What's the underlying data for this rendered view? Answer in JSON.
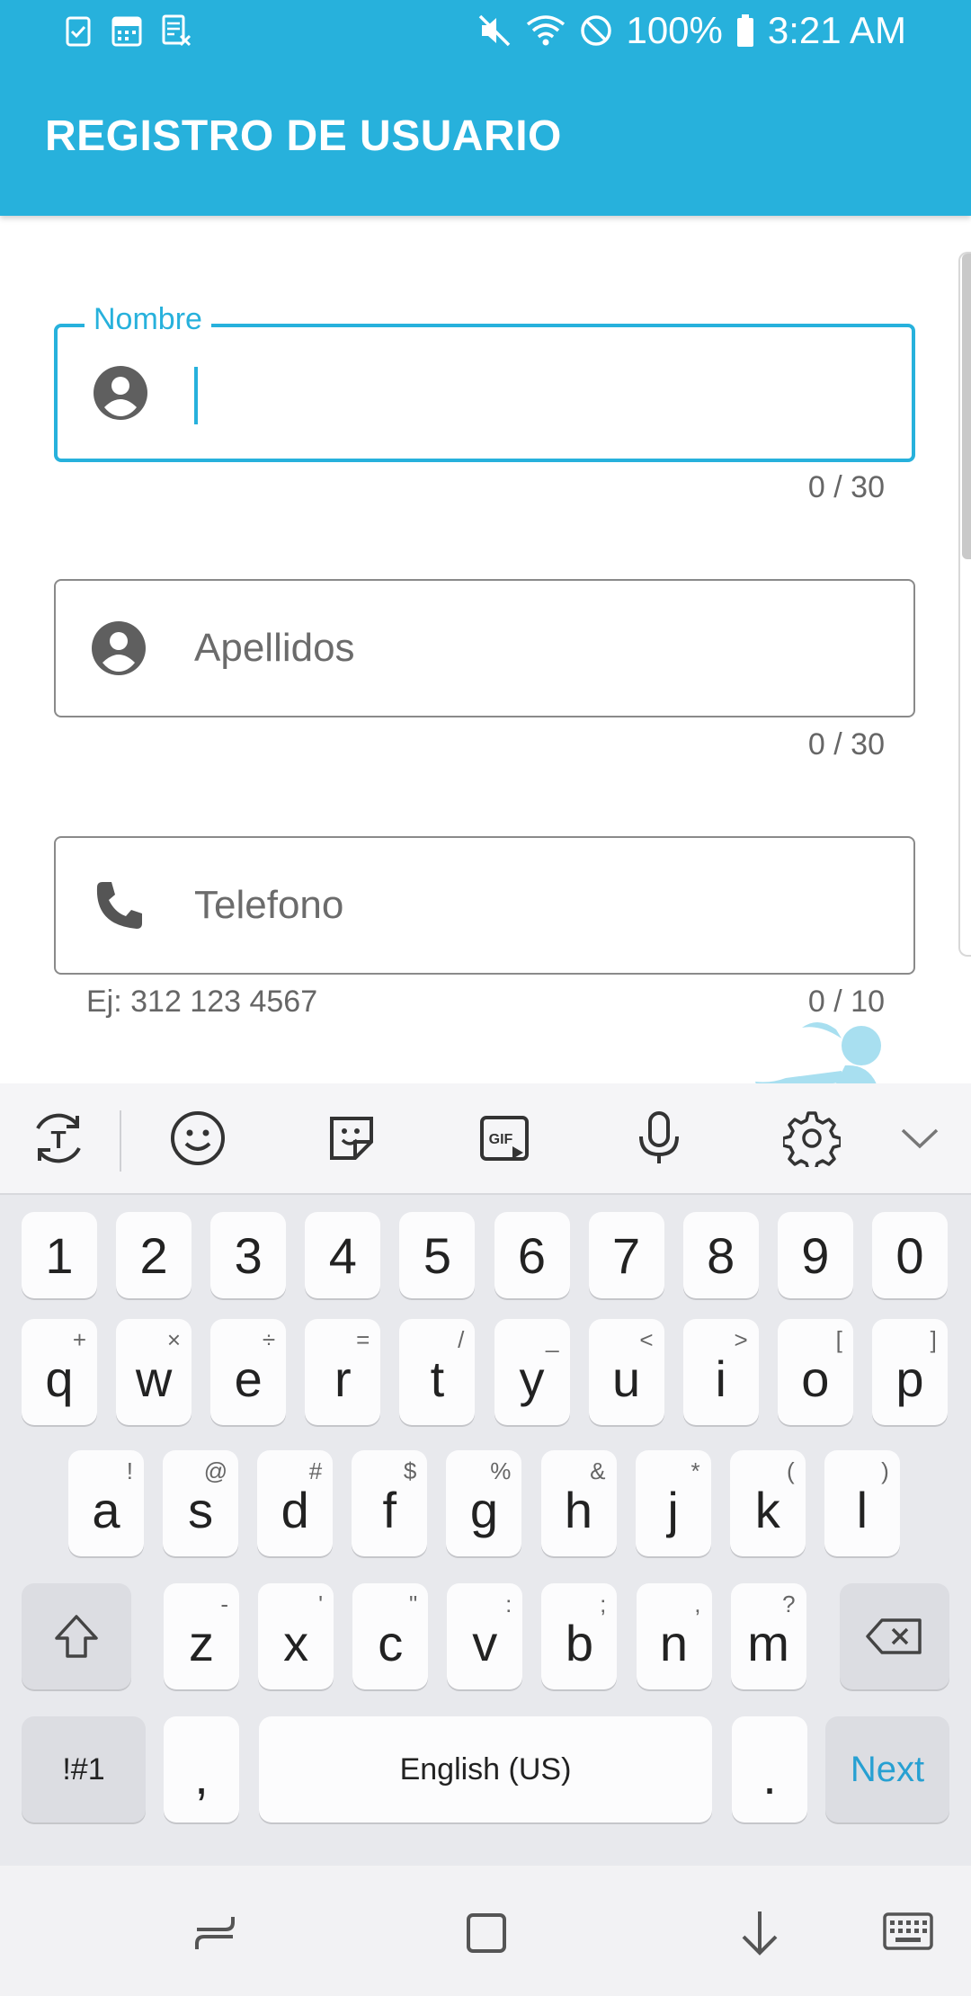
{
  "status_bar": {
    "battery": "100%",
    "time": "3:21 AM",
    "icons": [
      "clipboard-check-icon",
      "calendar-icon",
      "sheet-icon",
      "mute-icon",
      "wifi-icon",
      "blocked-icon",
      "battery-icon"
    ]
  },
  "app_bar": {
    "title": "REGISTRO DE USUARIO",
    "color": "#27b1dc"
  },
  "form": {
    "nombre": {
      "label": "Nombre",
      "value": "",
      "counter": "0 / 30",
      "icon": "account-circle-icon"
    },
    "apellidos": {
      "placeholder": "Apellidos",
      "counter": "0 / 30",
      "icon": "account-circle-icon"
    },
    "telefono": {
      "placeholder": "Telefono",
      "helper": "Ej: 312 123 4567",
      "counter": "0 / 10",
      "icon": "phone-icon"
    }
  },
  "keyboard": {
    "toolbar_icons": [
      "text-mode-icon",
      "emoji-icon",
      "sticker-icon",
      "gif-icon",
      "microphone-icon",
      "settings-icon",
      "collapse-icon"
    ],
    "number_row": [
      "1",
      "2",
      "3",
      "4",
      "5",
      "6",
      "7",
      "8",
      "9",
      "0"
    ],
    "row1": [
      {
        "k": "q",
        "h": "+"
      },
      {
        "k": "w",
        "h": "×"
      },
      {
        "k": "e",
        "h": "÷"
      },
      {
        "k": "r",
        "h": "="
      },
      {
        "k": "t",
        "h": "/"
      },
      {
        "k": "y",
        "h": "_"
      },
      {
        "k": "u",
        "h": "<"
      },
      {
        "k": "i",
        "h": ">"
      },
      {
        "k": "o",
        "h": "["
      },
      {
        "k": "p",
        "h": "]"
      }
    ],
    "row2": [
      {
        "k": "a",
        "h": "!"
      },
      {
        "k": "s",
        "h": "@"
      },
      {
        "k": "d",
        "h": "#"
      },
      {
        "k": "f",
        "h": "$"
      },
      {
        "k": "g",
        "h": "%"
      },
      {
        "k": "h",
        "h": "&"
      },
      {
        "k": "j",
        "h": "*"
      },
      {
        "k": "k",
        "h": "("
      },
      {
        "k": "l",
        "h": ")"
      }
    ],
    "row3": [
      {
        "k": "z",
        "h": "-"
      },
      {
        "k": "x",
        "h": "'"
      },
      {
        "k": "c",
        "h": "\""
      },
      {
        "k": "v",
        "h": ":"
      },
      {
        "k": "b",
        "h": ";"
      },
      {
        "k": "n",
        "h": ","
      },
      {
        "k": "m",
        "h": "?"
      }
    ],
    "symbols_key": "!#1",
    "comma_key": ",",
    "space_key": "English (US)",
    "period_key": ".",
    "action_key": "Next"
  },
  "nav_bar": {
    "icons": [
      "recent-apps-icon",
      "home-icon",
      "back-icon",
      "keyboard-switch-icon"
    ]
  }
}
